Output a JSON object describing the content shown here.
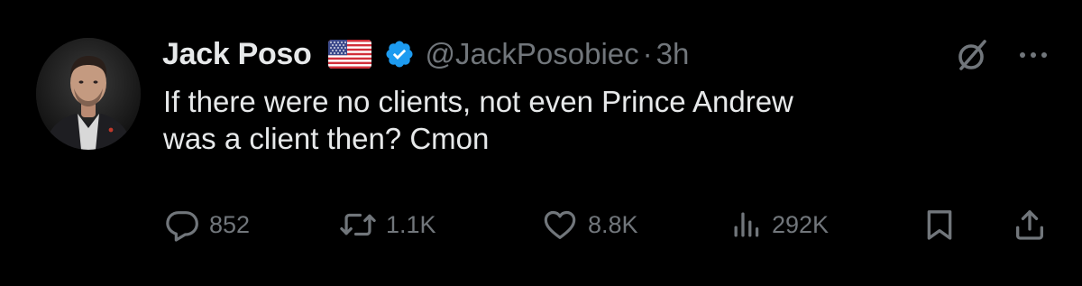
{
  "tweet": {
    "author": {
      "display_name": "Jack Poso",
      "flag_icon": "us-flag-icon",
      "verified_icon": "verified-badge-icon",
      "verified_color": "#1d9bf0",
      "handle": "@JackPosobiec",
      "separator": "·",
      "time": "3h"
    },
    "text": "If there were no clients, not even Prince Andrew\nwas a client then? Cmon",
    "actions": {
      "replies": "852",
      "retweets": "1.1K",
      "likes": "8.8K",
      "views": "292K"
    }
  },
  "icons": {
    "grok": "grok-icon",
    "more": "more-icon",
    "reply": "reply-icon",
    "retweet": "retweet-icon",
    "like": "heart-icon",
    "views": "views-icon",
    "bookmark": "bookmark-icon",
    "share": "share-icon"
  },
  "colors": {
    "background": "#000000",
    "primary_text": "#e7e9ea",
    "secondary_text": "#71767b"
  }
}
